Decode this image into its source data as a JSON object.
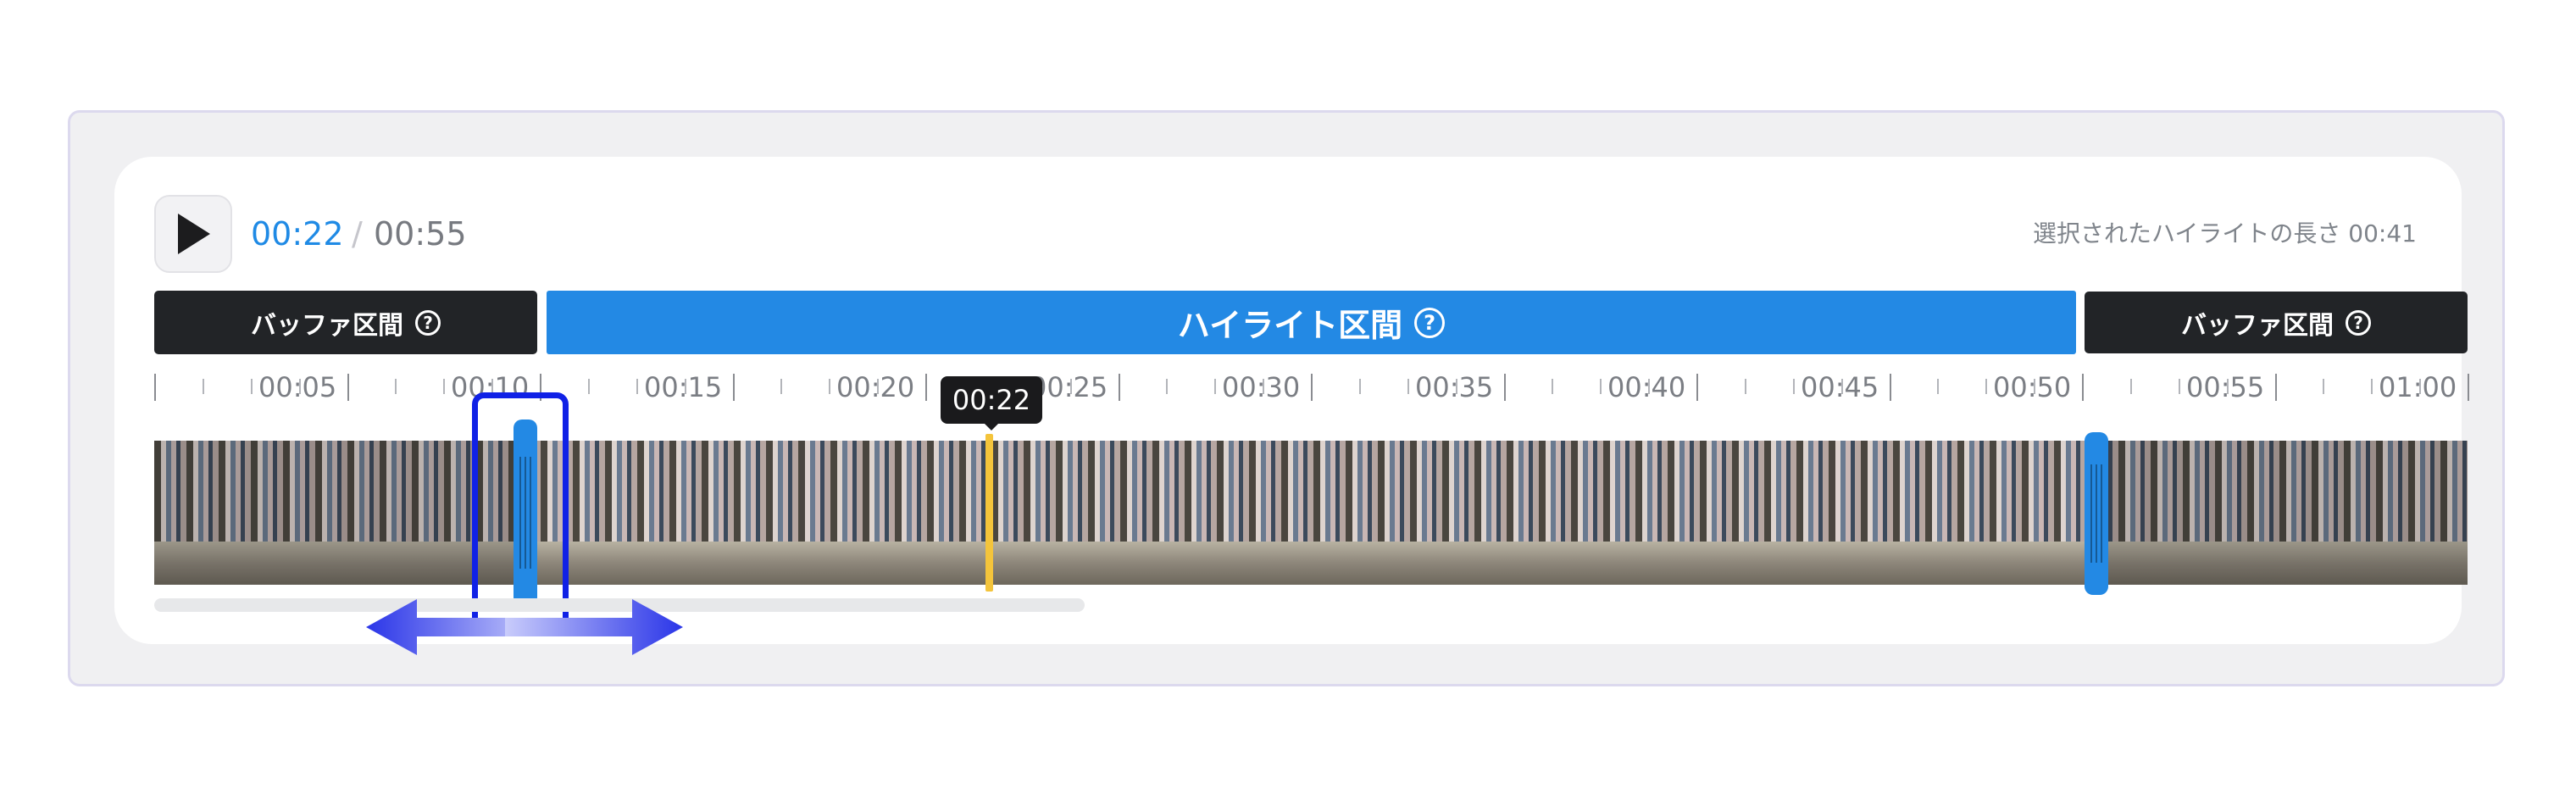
{
  "player": {
    "current_time": "00:22",
    "separator": "/",
    "total_time": "00:55",
    "play_icon": "play-icon"
  },
  "selection_info": {
    "label": "選択されたハイライトの長さ 00:41"
  },
  "zones": {
    "buffer_left": {
      "label": "バッファ区間",
      "help": "?"
    },
    "highlight": {
      "label": "ハイライト区間",
      "help": "?"
    },
    "buffer_right": {
      "label": "バッファ区間",
      "help": "?"
    }
  },
  "ruler": {
    "labels": [
      "00:05",
      "00:10",
      "00:15",
      "00:20",
      "00:25",
      "00:30",
      "00:35",
      "00:40",
      "00:45",
      "00:50",
      "00:55",
      "01:00"
    ]
  },
  "playhead": {
    "tooltip": "00:22"
  },
  "colors": {
    "accent": "#2389e4",
    "buffer": "#222427",
    "playhead": "#f4c43b",
    "selector": "#1021e6"
  },
  "icons": {
    "help": "question-circle-icon",
    "drag_hint": "double-arrow-icon"
  }
}
